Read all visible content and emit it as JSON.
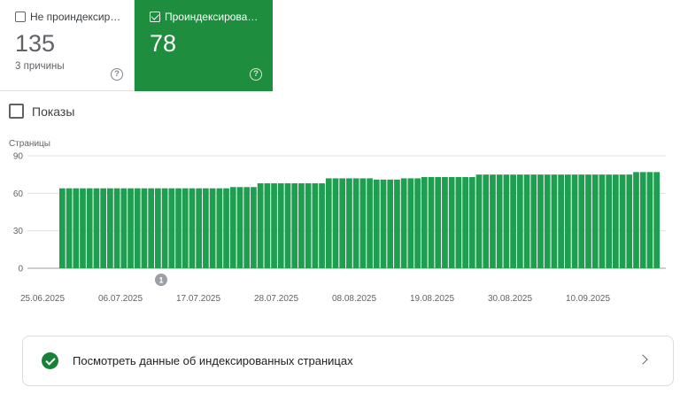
{
  "cards": {
    "not_indexed": {
      "label": "Не проиндексир…",
      "value": "135",
      "sub": "3 причины"
    },
    "indexed": {
      "label": "Проиндексирова…",
      "value": "78",
      "checked": true
    }
  },
  "impressions": {
    "label": "Показы",
    "checked": false
  },
  "link": {
    "text": "Посмотреть данные об индексированных страницах"
  },
  "annotation": "1",
  "colors": {
    "accent_green": "#1e8e3e",
    "bar_green": "#1e9e4f",
    "check_green": "#188038"
  },
  "chart_data": {
    "type": "bar",
    "ylabel": "Страницы",
    "ylim": [
      0,
      90
    ],
    "yticks": [
      "90",
      "60",
      "30",
      "0"
    ],
    "x_tick_labels": [
      "25.06.2025",
      "06.07.2025",
      "17.07.2025",
      "28.07.2025",
      "08.08.2025",
      "19.08.2025",
      "30.08.2025",
      "10.09.2025"
    ],
    "x_start": "2025-06-27",
    "values": [
      64,
      64,
      64,
      64,
      64,
      64,
      64,
      64,
      64,
      64,
      64,
      64,
      64,
      64,
      64,
      64,
      64,
      64,
      64,
      64,
      64,
      64,
      64,
      64,
      64,
      65,
      65,
      65,
      65,
      68,
      68,
      68,
      68,
      68,
      68,
      68,
      68,
      68,
      68,
      72,
      72,
      72,
      72,
      72,
      72,
      72,
      71,
      71,
      71,
      71,
      72,
      72,
      72,
      73,
      73,
      73,
      73,
      73,
      73,
      73,
      73,
      75,
      75,
      75,
      75,
      75,
      75,
      75,
      75,
      75,
      75,
      75,
      75,
      75,
      75,
      75,
      75,
      75,
      75,
      75,
      75,
      75,
      75,
      75,
      77,
      77,
      77,
      77
    ]
  }
}
